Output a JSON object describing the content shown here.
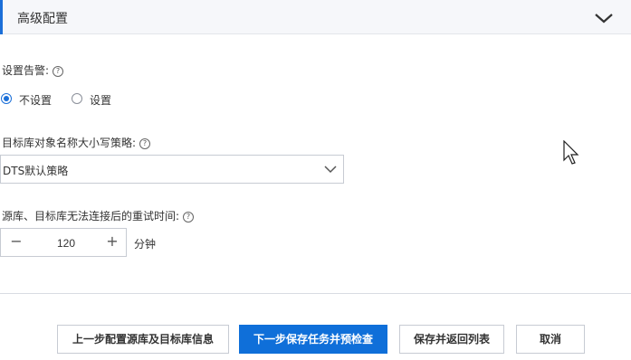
{
  "section": {
    "title": "高级配置"
  },
  "alert": {
    "label": "设置告警:",
    "options": [
      {
        "label": "不设置",
        "checked": true
      },
      {
        "label": "设置",
        "checked": false
      }
    ]
  },
  "case_policy": {
    "label": "目标库对象名称大小写策略:",
    "selected": "DTS默认策略"
  },
  "retry": {
    "label": "源库、目标库无法连接后的重试时间:",
    "value": "120",
    "unit": "分钟"
  },
  "footer": {
    "prev_label": "上一步配置源库及目标库信息",
    "next_label": "下一步保存任务并预检查",
    "save_return_label": "保存并返回列表",
    "cancel_label": "取消"
  },
  "colors": {
    "accent": "#0f6fd9",
    "header_bg": "#f6f7fa"
  }
}
